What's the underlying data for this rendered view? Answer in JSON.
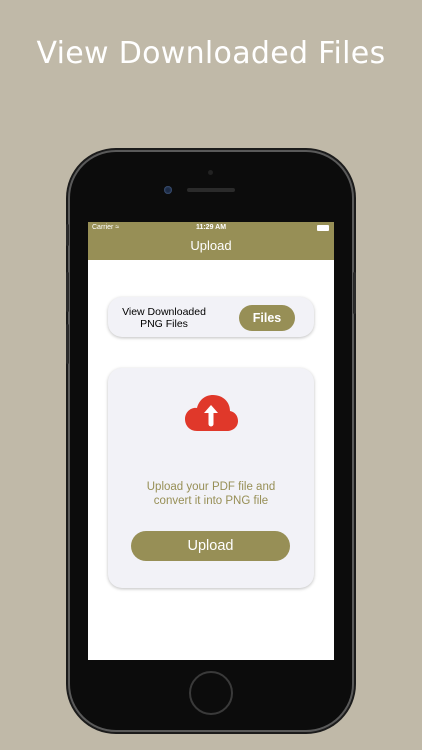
{
  "headline": "View Downloaded Files",
  "status_bar": {
    "carrier": "Carrier",
    "time": "11:29 AM"
  },
  "nav": {
    "title": "Upload"
  },
  "files_card": {
    "label_line1": "View Downloaded",
    "label_line2": "PNG Files",
    "button_label": "Files"
  },
  "upload_card": {
    "description_line1": "Upload your PDF file and",
    "description_line2": "convert it into PNG file",
    "button_label": "Upload",
    "icon": "cloud-upload-icon"
  },
  "colors": {
    "background": "#c0b9a8",
    "accent": "#978f56",
    "icon_red": "#e0382a",
    "card": "#f2f2f7"
  }
}
